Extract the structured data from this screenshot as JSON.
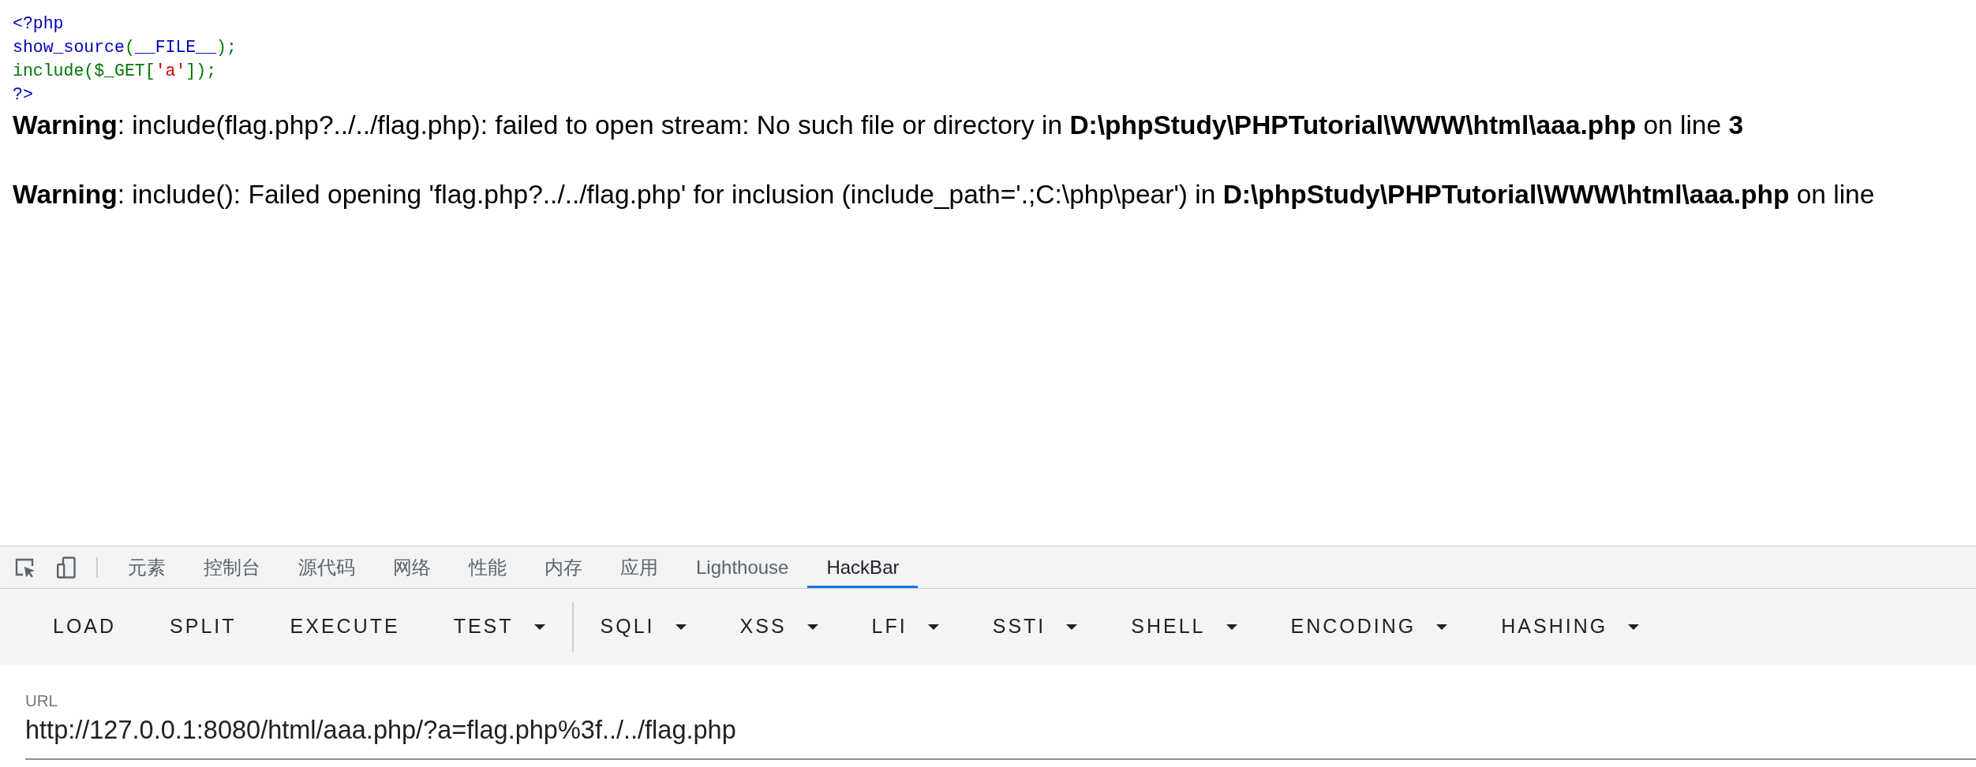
{
  "page": {
    "source_lines": [
      [
        {
          "kind": "default",
          "text": "<?php"
        }
      ],
      [
        {
          "kind": "default",
          "text": "show_source"
        },
        {
          "kind": "keyword",
          "text": "("
        },
        {
          "kind": "default",
          "text": "__FILE__"
        },
        {
          "kind": "keyword",
          "text": ");"
        }
      ],
      [
        {
          "kind": "keyword",
          "text": "include($_GET["
        },
        {
          "kind": "string",
          "text": "'a'"
        },
        {
          "kind": "keyword",
          "text": "]);"
        }
      ],
      [
        {
          "kind": "default",
          "text": "?>"
        }
      ]
    ],
    "warnings": [
      "**Warning**: include(flag.php?../../flag.php): failed to open stream: No such file or directory in **D:\\phpStudy\\PHPTutorial\\WWW\\html\\aaa.php** on line **3**",
      "**Warning**: include(): Failed opening 'flag.php?../../flag.php' for inclusion (include_path='.;C:\\php\\pear') in **D:\\phpStudy\\PHPTutorial\\WWW\\html\\aaa.php** on line"
    ]
  },
  "devtools": {
    "tabs": [
      {
        "label": "元素",
        "selected": false
      },
      {
        "label": "控制台",
        "selected": false
      },
      {
        "label": "源代码",
        "selected": false
      },
      {
        "label": "网络",
        "selected": false
      },
      {
        "label": "性能",
        "selected": false
      },
      {
        "label": "内存",
        "selected": false
      },
      {
        "label": "应用",
        "selected": false
      },
      {
        "label": "Lighthouse",
        "selected": false
      },
      {
        "label": "HackBar",
        "selected": true
      }
    ],
    "hackbar": {
      "button_groups": [
        [
          {
            "label": "LOAD",
            "kind": "action"
          },
          {
            "label": "SPLIT",
            "kind": "action"
          },
          {
            "label": "EXECUTE",
            "kind": "action"
          },
          {
            "label": "TEST",
            "kind": "menu"
          }
        ],
        [
          {
            "label": "SQLI",
            "kind": "menu"
          },
          {
            "label": "XSS",
            "kind": "menu"
          },
          {
            "label": "LFI",
            "kind": "menu"
          },
          {
            "label": "SSTI",
            "kind": "menu"
          },
          {
            "label": "SHELL",
            "kind": "menu"
          },
          {
            "label": "ENCODING",
            "kind": "menu"
          },
          {
            "label": "HASHING",
            "kind": "menu"
          }
        ]
      ],
      "url_field": {
        "label": "URL",
        "value": "http://127.0.0.1:8080/html/aaa.php/?a=flag.php%3f../../flag.php"
      }
    }
  }
}
